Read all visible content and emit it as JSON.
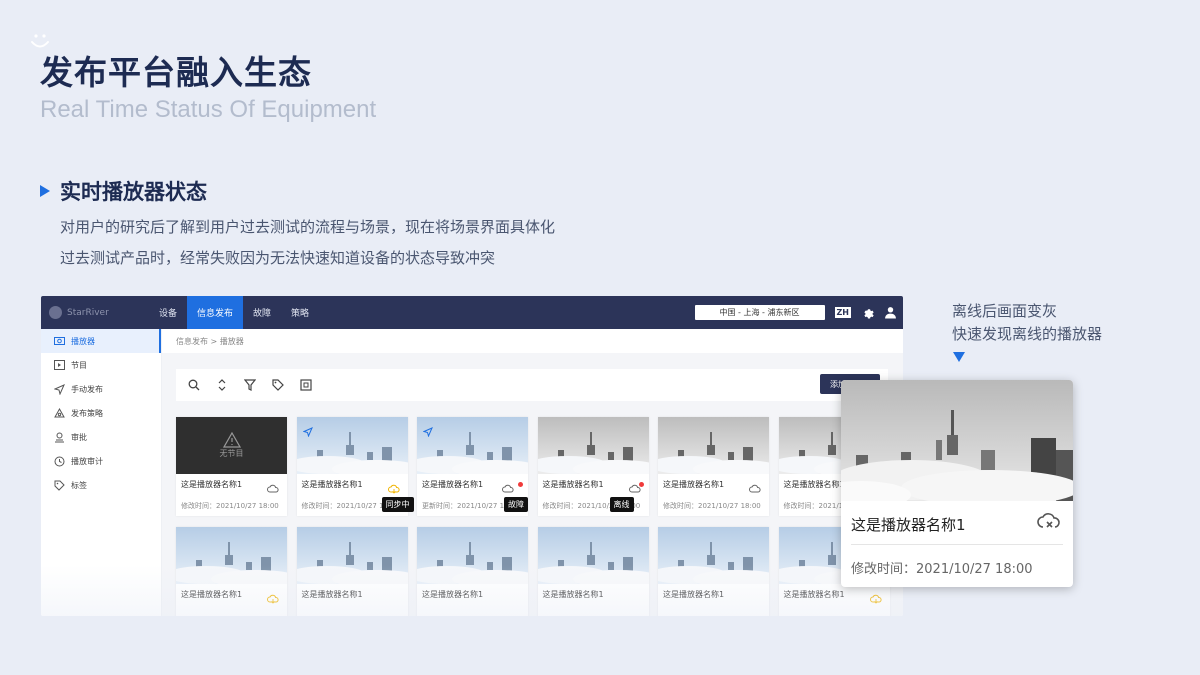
{
  "slide": {
    "title": "发布平台融入生态",
    "subtitle": "Real Time Status Of Equipment",
    "section_title": "实时播放器状态",
    "desc1": "对用户的研究后了解到用户过去测试的流程与场景，现在将场景界面具体化",
    "desc2": "过去测试产品时，经常失败因为无法快速知道设备的状态导致冲突",
    "note_line1": "离线后画面变灰",
    "note_line2": "快速发现离线的播放器"
  },
  "app": {
    "logo_text": "StarRiver",
    "nav": [
      "设备",
      "信息发布",
      "故障",
      "策略"
    ],
    "nav_active": 1,
    "region": "中国 - 上海 - 浦东新区",
    "lang": "ZH",
    "sidebar": [
      {
        "label": "播放器",
        "icon": "player-icon",
        "active": true
      },
      {
        "label": "节目",
        "icon": "program-icon",
        "active": false
      },
      {
        "label": "手动发布",
        "icon": "send-icon",
        "active": false
      },
      {
        "label": "发布策略",
        "icon": "strategy-icon",
        "active": false
      },
      {
        "label": "审批",
        "icon": "approve-icon",
        "active": false
      },
      {
        "label": "播放审计",
        "icon": "audit-icon",
        "active": false
      },
      {
        "label": "标签",
        "icon": "tag-icon",
        "active": false
      }
    ],
    "breadcrumb": "信息发布 > 播放器",
    "add_button": "添加",
    "cards_row1": [
      {
        "name": "这是播放器名称1",
        "time": "修改时间：2021/10/27 18:00",
        "empty": true,
        "empty_text": "无节目",
        "status": "none"
      },
      {
        "name": "这是播放器名称1",
        "time": "修改时间：2021/10/27 18:00",
        "status": "syncing",
        "badge": "同步中",
        "send": true
      },
      {
        "name": "这是播放器名称1",
        "time": "更新时间：2021/10/27 18:00",
        "status": "fault",
        "badge": "故障",
        "send": true
      },
      {
        "name": "这是播放器名称1",
        "time": "修改时间：2021/10/27 18:00",
        "status": "offline",
        "badge": "离线",
        "gray": true
      },
      {
        "name": "这是播放器名称1",
        "time": "修改时间：2021/10/27 18:00",
        "status": "offline",
        "gray": true
      },
      {
        "name": "这是播放器名称1",
        "time": "修改时间：2021/10/27 18:00",
        "status": "offline",
        "gray": true
      }
    ],
    "cards_row2": [
      {
        "name": "这是播放器名称1",
        "status": "syncing"
      },
      {
        "name": "这是播放器名称1",
        "status": "none"
      },
      {
        "name": "这是播放器名称1",
        "status": "none"
      },
      {
        "name": "这是播放器名称1",
        "status": "none"
      },
      {
        "name": "这是播放器名称1",
        "status": "none"
      },
      {
        "name": "这是播放器名称1",
        "status": "syncing"
      }
    ]
  },
  "zoom_card": {
    "name": "这是播放器名称1",
    "time": "修改时间：2021/10/27 18:00",
    "status": "offline"
  },
  "colors": {
    "accent": "#1f6fe0",
    "topbar": "#2c3459",
    "sync": "#f0b400",
    "fault": "#f03b3b"
  }
}
